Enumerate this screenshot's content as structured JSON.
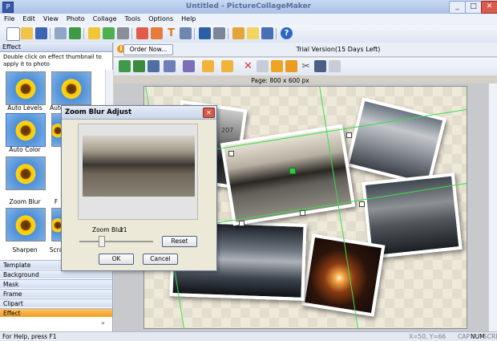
{
  "window": {
    "title": "Untitled - PictureCollageMaker"
  },
  "menu": [
    "File",
    "Edit",
    "View",
    "Photo",
    "Collage",
    "Tools",
    "Options",
    "Help"
  ],
  "left_panel": {
    "header": "Effect",
    "hint": "Double click on effect thumbnail to apply it to photo",
    "thumbnails": [
      "Auto Levels",
      "Auto Contrast",
      "Auto Color",
      "",
      "Zoom Blur",
      "F",
      "Sharpen",
      "Scra"
    ],
    "accordion": [
      "Template",
      "Background",
      "Mask",
      "Frame",
      "Clipart",
      "Effect"
    ]
  },
  "order_bar": {
    "button": "Order Now...",
    "trial": "Trial Version(15 Days Left)"
  },
  "canvas": {
    "page_label": "Page: 800 x 600 px",
    "angle_readout": "207"
  },
  "dialog": {
    "title": "Zoom Blur Adjust",
    "param_label": "Zoom Blur",
    "param_value": "11",
    "slider_fraction": 0.3,
    "reset": "Reset",
    "ok": "OK",
    "cancel": "Cancel"
  },
  "status": {
    "left": "For Help, press F1",
    "coords": "X=50, Y=66",
    "cap": "CAP",
    "num": "NUM",
    "scrl": "SCRL"
  },
  "colors": {
    "accent": "#f29d1f",
    "selection": "#37e04a"
  }
}
